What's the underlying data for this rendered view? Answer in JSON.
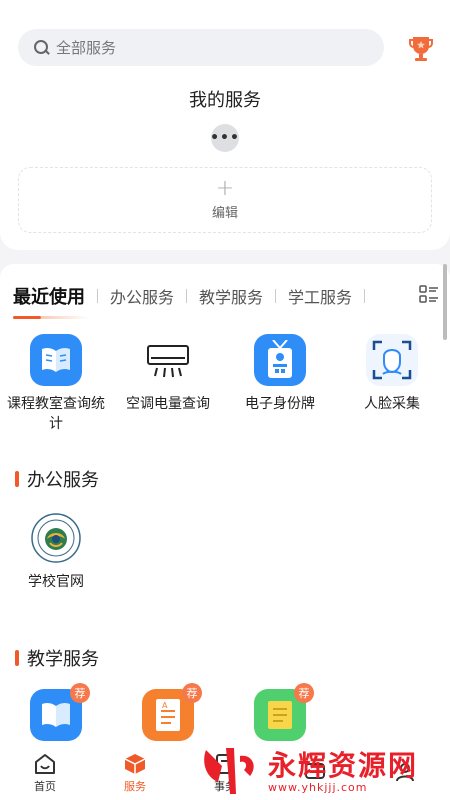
{
  "search": {
    "placeholder": "全部服务",
    "icon": "search-icon"
  },
  "header": {
    "trophy_icon": "trophy-icon"
  },
  "my_services": {
    "title": "我的服务",
    "more_glyph": "•••",
    "edit_label": "编辑"
  },
  "tabs": [
    {
      "label": "最近使用",
      "active": true
    },
    {
      "label": "办公服务",
      "active": false
    },
    {
      "label": "教学服务",
      "active": false
    },
    {
      "label": "学工服务",
      "active": false
    }
  ],
  "recent_apps": [
    {
      "label": "课程教室查询统计",
      "icon": "book-icon",
      "color": "#2e8df7"
    },
    {
      "label": "空调电量查询",
      "icon": "air-conditioner-icon",
      "color": "#ffffff"
    },
    {
      "label": "电子身份牌",
      "icon": "id-badge-icon",
      "color": "#2e8df7"
    },
    {
      "label": "人脸采集",
      "icon": "face-scan-icon",
      "color": "#eef5ff"
    }
  ],
  "office_section": {
    "title": "办公服务",
    "apps": [
      {
        "label": "学校官网",
        "icon": "school-logo-icon"
      }
    ]
  },
  "teaching_section": {
    "title": "教学服务",
    "badge": "荐",
    "apps": [
      {
        "icon": "book-icon",
        "color": "#2e8df7"
      },
      {
        "icon": "document-icon",
        "color": "#f5812f"
      },
      {
        "icon": "notes-icon",
        "color": "#4fcf6e"
      }
    ]
  },
  "bottom_nav": [
    {
      "label": "首页",
      "icon": "home-icon",
      "active": false
    },
    {
      "label": "服务",
      "icon": "cube-icon",
      "active": true
    },
    {
      "label": "事务",
      "icon": "calendar-icon",
      "active": false
    },
    {
      "label": "",
      "icon": "message-icon",
      "active": false
    },
    {
      "label": "",
      "icon": "user-icon",
      "active": false
    }
  ],
  "watermark": {
    "text": "永辉资源网",
    "url": "www.yhkjjj.com"
  },
  "colors": {
    "accent": "#f05a28",
    "blue": "#2e8df7",
    "watermark": "#e8202a"
  }
}
